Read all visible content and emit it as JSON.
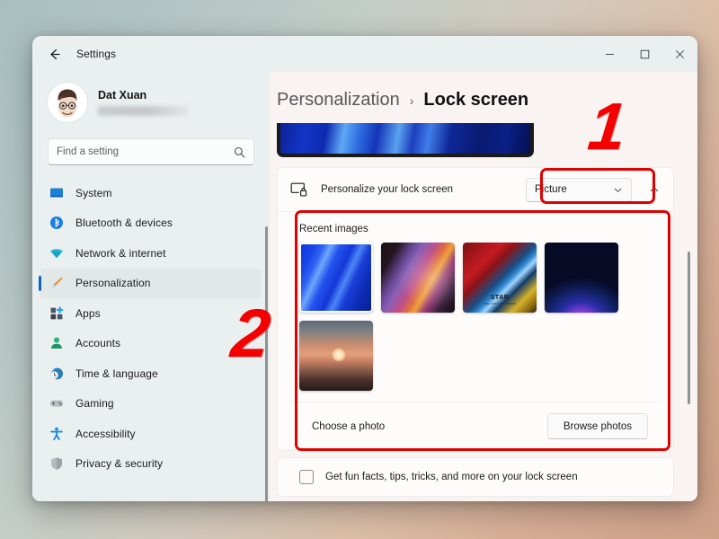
{
  "window": {
    "title": "Settings",
    "back_icon": "back-arrow-icon",
    "controls": {
      "minimize": "minimize-icon",
      "maximize": "maximize-icon",
      "close": "close-icon"
    }
  },
  "sidebar": {
    "account": {
      "name": "Dat Xuan",
      "email_redacted": ""
    },
    "search": {
      "placeholder": "Find a setting",
      "value": "",
      "icon": "search-icon"
    },
    "items": [
      {
        "label": "System",
        "icon": "monitor-icon",
        "selected": false
      },
      {
        "label": "Bluetooth & devices",
        "icon": "bluetooth-icon",
        "selected": false
      },
      {
        "label": "Network & internet",
        "icon": "wifi-icon",
        "selected": false
      },
      {
        "label": "Personalization",
        "icon": "paintbrush-icon",
        "selected": true
      },
      {
        "label": "Apps",
        "icon": "apps-icon",
        "selected": false
      },
      {
        "label": "Accounts",
        "icon": "person-icon",
        "selected": false
      },
      {
        "label": "Time & language",
        "icon": "clock-globe-icon",
        "selected": false
      },
      {
        "label": "Gaming",
        "icon": "gamepad-icon",
        "selected": false
      },
      {
        "label": "Accessibility",
        "icon": "accessibility-icon",
        "selected": false
      },
      {
        "label": "Privacy & security",
        "icon": "shield-icon",
        "selected": false
      }
    ]
  },
  "content": {
    "breadcrumb": {
      "parent": "Personalization",
      "separator": "›",
      "current": "Lock screen"
    },
    "personalize_row": {
      "icon": "lock-screen-icon",
      "label": "Personalize your lock screen",
      "dropdown_value": "Picture",
      "dropdown_caret": "chevron-down-icon",
      "expander_icon": "chevron-up-icon"
    },
    "recent_images": {
      "title": "Recent images",
      "thumbnails": [
        {
          "name": "windows-11-bloom-blue",
          "selected": true
        },
        {
          "name": "abstract-ribbons-purple-orange"
        },
        {
          "name": "star-wars-poster",
          "caption": "STAR",
          "subcaption": "THE LAST JEDI WARS"
        },
        {
          "name": "dark-blue-purple-crescent"
        },
        {
          "name": "sunset-over-lake"
        }
      ]
    },
    "choose_photo": {
      "label": "Choose a photo",
      "button": "Browse photos"
    },
    "fun_facts": {
      "label": "Get fun facts, tips, tricks, and more on your lock screen",
      "checked": false
    }
  },
  "annotations": [
    {
      "id": "1",
      "label": "1"
    },
    {
      "id": "2",
      "label": "2"
    }
  ],
  "colors": {
    "accent": "#0d64b8",
    "annotation_red": "#e00000",
    "window_bg": "#f3f3f3",
    "sidebar_bg": "#eaeff0",
    "content_bg": "#f9f4f2"
  }
}
